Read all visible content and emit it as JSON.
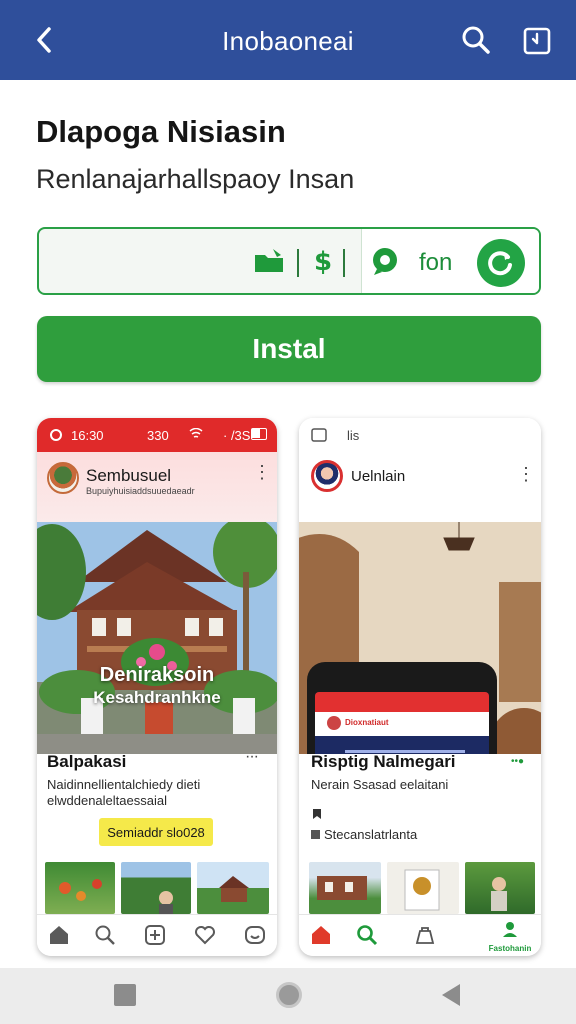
{
  "appbar": {
    "title": "Inobaoneai",
    "back_icon": "arrow-left-icon",
    "search_icon": "search-icon",
    "share_icon": "share-icon"
  },
  "app": {
    "name": "Dlapoga Nisiasin",
    "subtitle": "Renlanajarhallspaoy Insan"
  },
  "features": {
    "label": "fon",
    "icons": [
      "folder-icon",
      "dollar-icon",
      "chat-icon",
      "refresh-icon"
    ]
  },
  "install": {
    "label": "Instal"
  },
  "screens": [
    {
      "status_left": "16:30",
      "status_mid": "330",
      "status_right": "· /3S",
      "profile_name": "Sembusuel",
      "profile_sub": "Bupuiyhuisiaddsuuedaeadr",
      "hero_text_line1": "Deniraksoin",
      "hero_text_line2": "Kesahdranhkne",
      "post_title": "Balpakasi",
      "post_desc_line1": "Naidinnellientalchiedy dieti",
      "post_desc_line2": "elwddenaleltaessaial",
      "promo_label": "Semiaddr slo028"
    },
    {
      "status_left": "lis",
      "profile_name": "Uelnlain",
      "inner_title": "Dioxnatiaut",
      "post_title": "Risptig Nalmegari",
      "post_desc_line1": "Nerain Ssasad eelaitani",
      "post_link": "Stecanslatrlanta",
      "active_tab_label": "Fastohanin",
      "badge": "••●"
    }
  ],
  "colors": {
    "appbar": "#2f4f9b",
    "accent_green": "#2f9e3d",
    "card_red": "#e02a2a",
    "promo_yellow": "#f5e94a"
  }
}
